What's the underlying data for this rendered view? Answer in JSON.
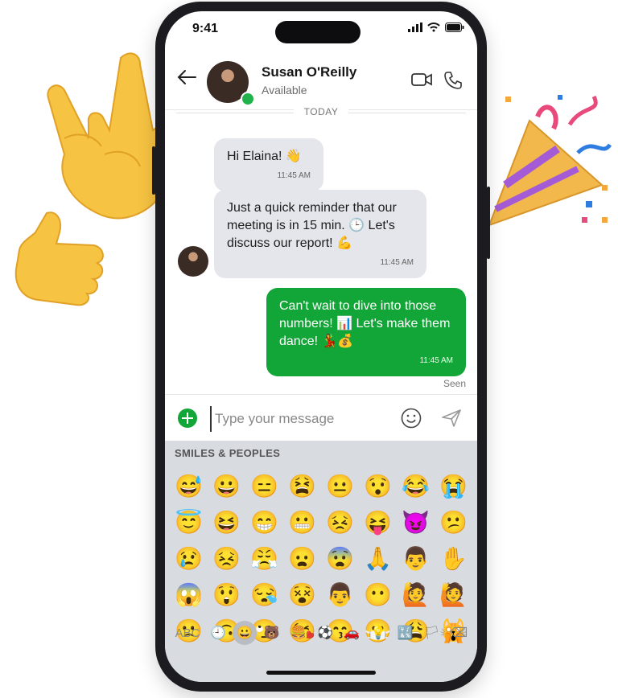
{
  "status": {
    "time": "9:41"
  },
  "header": {
    "name": "Susan O'Reilly",
    "presence": "Available"
  },
  "chat": {
    "date_divider": "TODAY",
    "messages": [
      {
        "direction": "in",
        "text": "Hi Elaina! 👋",
        "time": "11:45 AM"
      },
      {
        "direction": "in",
        "text": "Just a quick reminder that our meeting is in 15 min. 🕒 Let's discuss our report! 💪",
        "time": "11:45 AM"
      },
      {
        "direction": "out",
        "text": "Can't wait to dive into those numbers! 📊 Let's make them dance! 💃💰",
        "time": "11:45 AM"
      }
    ],
    "seen": "Seen"
  },
  "composer": {
    "placeholder": "Type your message"
  },
  "keyboard": {
    "category": "SMILES & PEOPLES",
    "emojis": [
      "😅",
      "😀",
      "😑",
      "😫",
      "😐",
      "😯",
      "😂",
      "😭",
      "😇",
      "😆",
      "😁",
      "😬",
      "😣",
      "😝",
      "😈",
      "😕",
      "😢",
      "😣",
      "😤",
      "😦",
      "😨",
      "🙏",
      "👨",
      "✋",
      "😱",
      "😲",
      "😪",
      "😵",
      "👨",
      "😶",
      "🙋",
      "🙋",
      "🙁",
      "🙃",
      "🙄",
      "😘",
      "😙",
      "😷",
      "😩",
      "🙀"
    ],
    "tabs": [
      {
        "name": "abc",
        "label": "ABC"
      },
      {
        "name": "recent",
        "label": "🕘"
      },
      {
        "name": "smileys",
        "label": "😀"
      },
      {
        "name": "animals",
        "label": "🐻"
      },
      {
        "name": "food",
        "label": "🍔"
      },
      {
        "name": "activity",
        "label": "⚽"
      },
      {
        "name": "travel",
        "label": "🚗"
      },
      {
        "name": "objects",
        "label": "💡"
      },
      {
        "name": "symbols",
        "label": "🔣"
      },
      {
        "name": "flags",
        "label": "🏳"
      },
      {
        "name": "delete",
        "label": "⌫"
      }
    ]
  }
}
